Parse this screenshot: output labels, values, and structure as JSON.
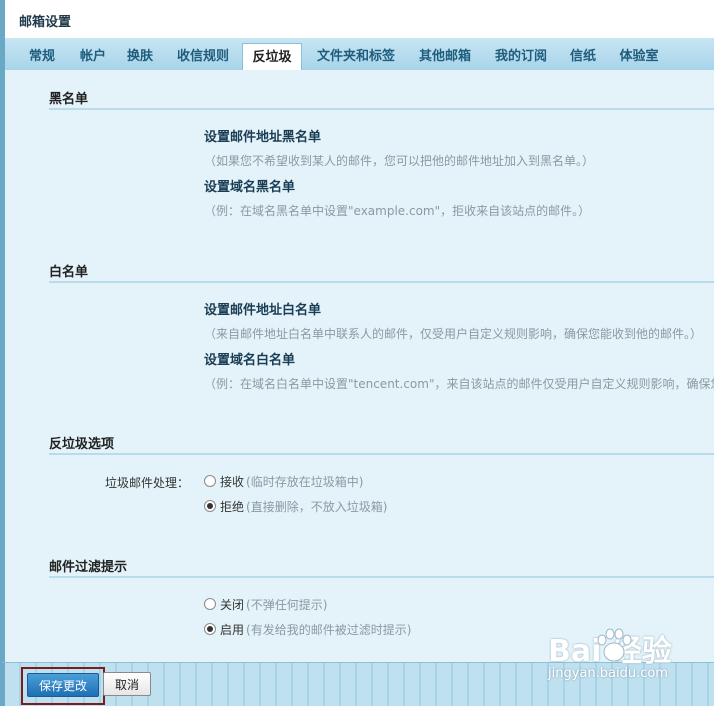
{
  "window": {
    "title": "邮箱设置"
  },
  "tabs": [
    {
      "label": "常规"
    },
    {
      "label": "帐户"
    },
    {
      "label": "换肤"
    },
    {
      "label": "收信规则"
    },
    {
      "label": "反垃圾",
      "active": true
    },
    {
      "label": "文件夹和标签"
    },
    {
      "label": "其他邮箱"
    },
    {
      "label": "我的订阅"
    },
    {
      "label": "信纸"
    },
    {
      "label": "体验室"
    }
  ],
  "blacklist": {
    "title": "黑名单",
    "address": {
      "title": "设置邮件地址黑名单",
      "desc": "（如果您不希望收到某人的邮件，您可以把他的邮件地址加入到黑名单。）"
    },
    "domain": {
      "title": "设置域名黑名单",
      "desc": "（例：在域名黑名单中设置\"example.com\"，拒收来自该站点的邮件。）"
    }
  },
  "whitelist": {
    "title": "白名单",
    "address": {
      "title": "设置邮件地址白名单",
      "desc": "（来自邮件地址白名单中联系人的邮件，仅受用户自定义规则影响，确保您能收到他的邮件。）"
    },
    "domain": {
      "title": "设置域名白名单",
      "desc": "（例：在域名白名单中设置\"tencent.com\"，来自该站点的邮件仅受用户自定义规则影响，确保您"
    }
  },
  "antispam": {
    "title": "反垃圾选项",
    "field_label": "垃圾邮件处理：",
    "options": [
      {
        "label": "接收",
        "hint": "(临时存放在垃圾箱中)",
        "checked": false
      },
      {
        "label": "拒绝",
        "hint": "(直接删除，不放入垃圾箱)",
        "checked": true
      }
    ]
  },
  "filter_notice": {
    "title": "邮件过滤提示",
    "options": [
      {
        "label": "关闭",
        "hint": "(不弹任何提示)",
        "checked": false
      },
      {
        "label": "启用",
        "hint": "(有发给我的邮件被过滤时提示)",
        "checked": true
      }
    ]
  },
  "actions": {
    "save_label": "保存更改",
    "cancel_label": "取消"
  },
  "watermark": {
    "logo_text": "Bai 经验",
    "url": "jingyan.baidu.com"
  }
}
